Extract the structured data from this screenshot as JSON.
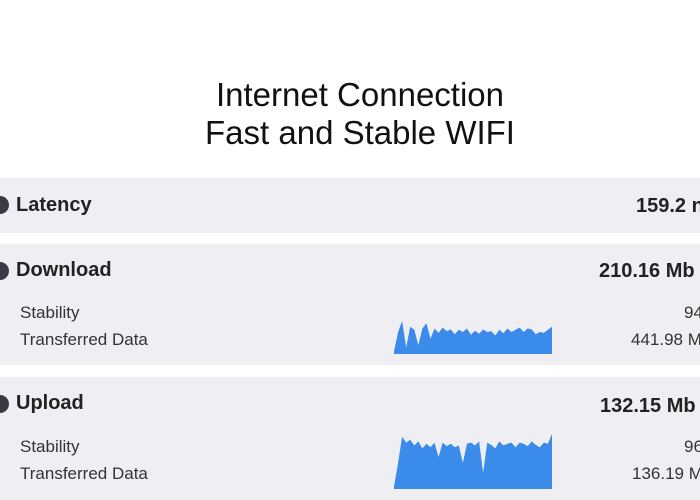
{
  "header": {
    "title_line1": "Internet Connection",
    "title_line2": "Fast and Stable WIFI"
  },
  "latency": {
    "label": "Latency",
    "value": "159.2 n"
  },
  "download": {
    "label": "Download",
    "value": "210.16 Mb",
    "stability_label": "Stability",
    "stability_value": "94",
    "transferred_label": "Transferred Data",
    "transferred_value": "441.98 M",
    "series": [
      0.06,
      0.5,
      0.75,
      0.15,
      0.62,
      0.55,
      0.2,
      0.58,
      0.7,
      0.35,
      0.58,
      0.48,
      0.6,
      0.52,
      0.56,
      0.45,
      0.55,
      0.5,
      0.58,
      0.44,
      0.53,
      0.46,
      0.56,
      0.5,
      0.52,
      0.42,
      0.55,
      0.47,
      0.58,
      0.5,
      0.55,
      0.6,
      0.5,
      0.58,
      0.56,
      0.45,
      0.5,
      0.48,
      0.55,
      0.62
    ]
  },
  "upload": {
    "label": "Upload",
    "value": "132.15 Mb",
    "stability_label": "Stability",
    "stability_value": "96",
    "transferred_label": "Transferred Data",
    "transferred_value": "136.19 M",
    "series": [
      0.04,
      0.45,
      0.9,
      0.8,
      0.85,
      0.75,
      0.82,
      0.7,
      0.78,
      0.72,
      0.8,
      0.55,
      0.8,
      0.74,
      0.78,
      0.72,
      0.75,
      0.45,
      0.78,
      0.8,
      0.75,
      0.82,
      0.28,
      0.8,
      0.76,
      0.7,
      0.82,
      0.75,
      0.78,
      0.8,
      0.72,
      0.8,
      0.78,
      0.74,
      0.82,
      0.76,
      0.72,
      0.8,
      0.78,
      0.95
    ]
  },
  "colors": {
    "sparkline_fill": "#3b8beb",
    "card_background": "#efeff3",
    "status_dot": "#3a3a44"
  }
}
